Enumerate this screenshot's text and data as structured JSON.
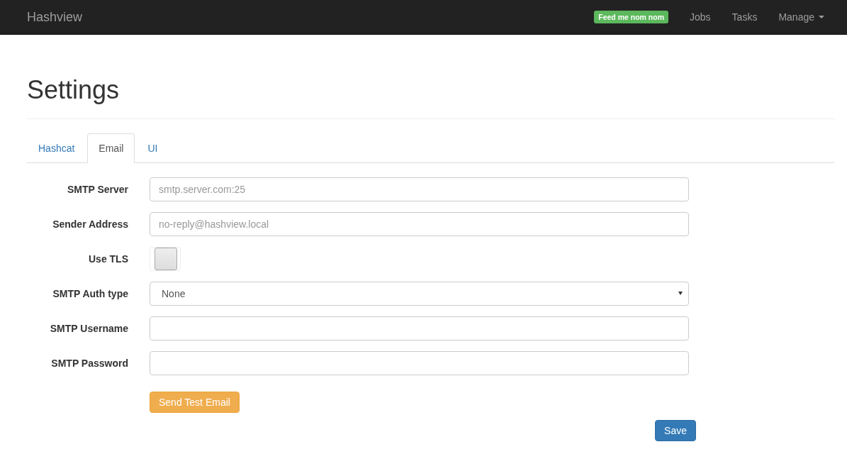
{
  "navbar": {
    "brand": "Hashview",
    "badge": "Feed me nom nom",
    "links": [
      {
        "label": "Jobs",
        "dropdown": false
      },
      {
        "label": "Tasks",
        "dropdown": false
      },
      {
        "label": "Manage",
        "dropdown": true
      }
    ]
  },
  "page": {
    "title": "Settings"
  },
  "tabs": [
    {
      "label": "Hashcat",
      "selected": false
    },
    {
      "label": "Email",
      "selected": true
    },
    {
      "label": "UI",
      "selected": false
    }
  ],
  "fields": [
    {
      "kind": "text",
      "label": "SMTP Server",
      "placeholder": "smtp.server.com:25"
    },
    {
      "kind": "text",
      "label": "Sender Address",
      "placeholder": "no-reply@hashview.local"
    },
    {
      "kind": "toggle",
      "label": "Use TLS",
      "checked": false
    },
    {
      "kind": "select",
      "label": "SMTP Auth type",
      "value": "None"
    },
    {
      "kind": "text",
      "label": "SMTP Username"
    },
    {
      "kind": "password",
      "label": "SMTP Password"
    }
  ],
  "buttons": {
    "test": "Send Test Email",
    "save": "Save"
  }
}
